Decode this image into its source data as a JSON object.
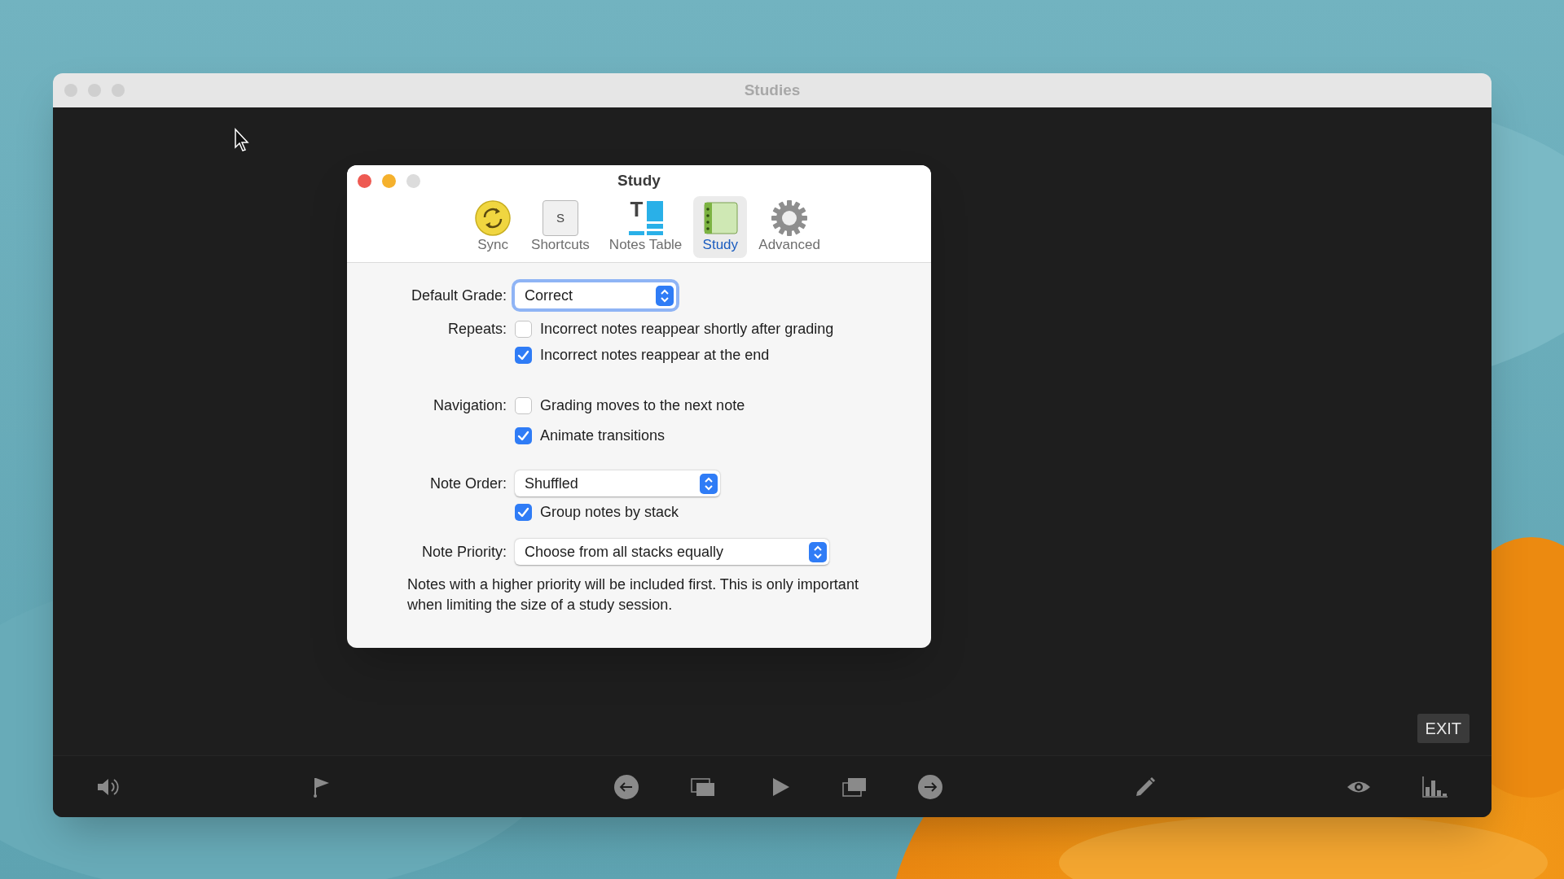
{
  "window": {
    "title": "Studies"
  },
  "dialog": {
    "title": "Study",
    "tabs": [
      {
        "label": "Sync",
        "kind": "sync",
        "selected": false
      },
      {
        "label": "Shortcuts",
        "kind": "key",
        "key_label": "S",
        "selected": false
      },
      {
        "label": "Notes Table",
        "kind": "table",
        "key_label": "T",
        "selected": false
      },
      {
        "label": "Study",
        "kind": "notebook",
        "selected": true
      },
      {
        "label": "Advanced",
        "kind": "gear",
        "selected": false
      }
    ],
    "default_grade": {
      "label": "Default Grade:",
      "value": "Correct",
      "focused": true
    },
    "repeats": {
      "label": "Repeats:",
      "options": [
        {
          "label": "Incorrect notes reappear shortly after grading",
          "checked": false
        },
        {
          "label": "Incorrect notes reappear at the end",
          "checked": true
        }
      ]
    },
    "navigation": {
      "label": "Navigation:",
      "options": [
        {
          "label": "Grading moves to the next note",
          "checked": false
        },
        {
          "label": "Animate transitions",
          "checked": true
        }
      ]
    },
    "note_order": {
      "label": "Note Order:",
      "value": "Shuffled",
      "focused": false,
      "options": [
        {
          "label": "Group notes by stack",
          "checked": true
        }
      ]
    },
    "note_priority": {
      "label": "Note Priority:",
      "value": "Choose from all stacks equally",
      "focused": false
    },
    "description": "Notes with a higher priority will be included first. This is only important when limiting the size of a study session."
  },
  "exit_button": "EXIT",
  "toolbar": [
    {
      "kind": "speaker"
    },
    {
      "kind": "flag"
    },
    {
      "kind": "back"
    },
    {
      "kind": "cards-back"
    },
    {
      "kind": "play"
    },
    {
      "kind": "cards-forward"
    },
    {
      "kind": "forward"
    },
    {
      "kind": "pencil"
    },
    {
      "kind": "eye"
    },
    {
      "kind": "chart"
    }
  ]
}
